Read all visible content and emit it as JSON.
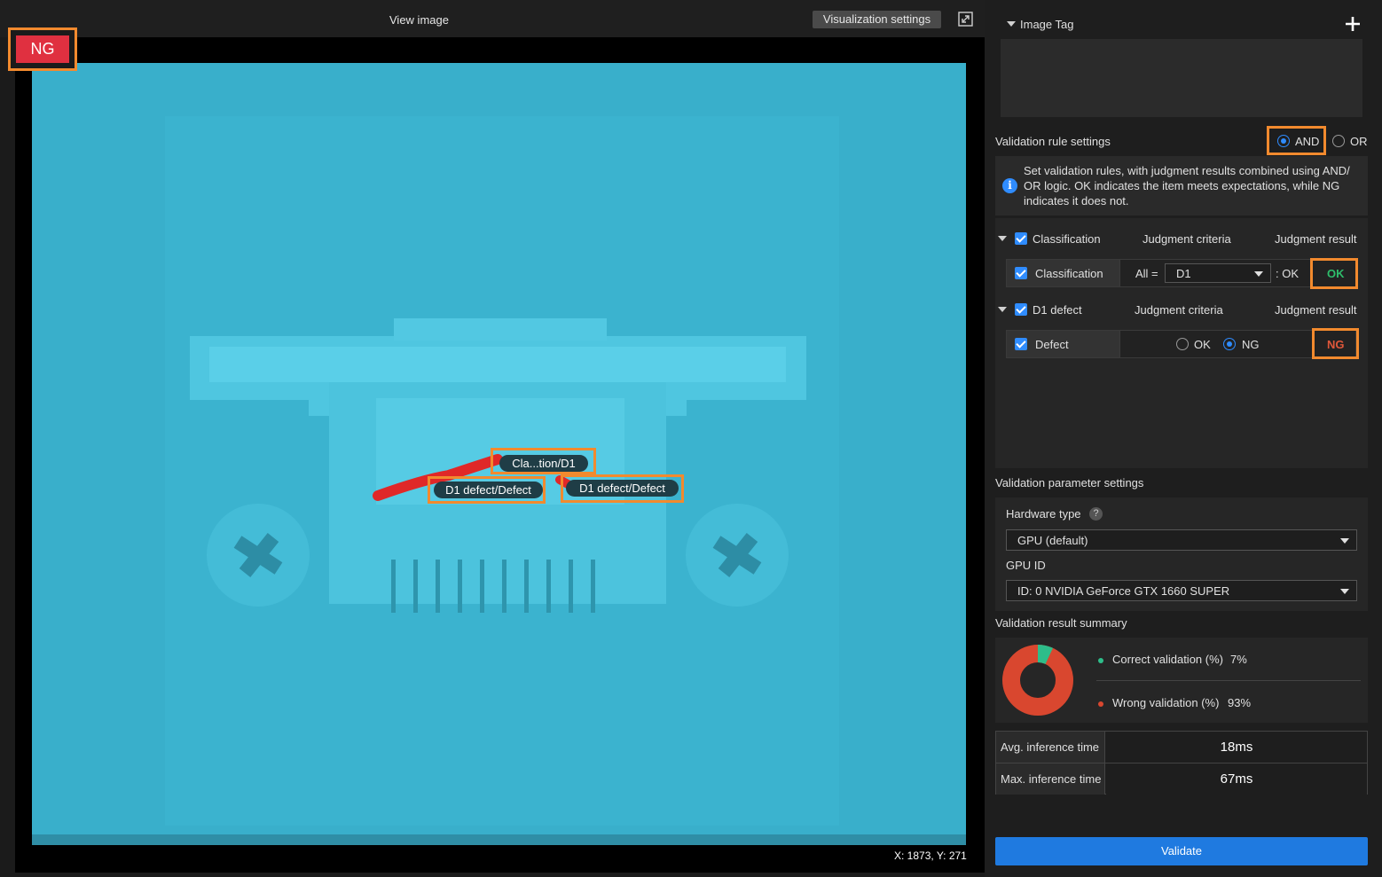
{
  "viewer": {
    "title": "View image",
    "visualization_settings_label": "Visualization settings",
    "result_badge": "NG",
    "coords": "X: 1873, Y: 271",
    "tags": [
      "Cla...tion/D1",
      "D1 defect/Defect",
      "D1 defect/Defect"
    ]
  },
  "image_tag": {
    "title": "Image Tag"
  },
  "validation_rule": {
    "title": "Validation rule settings",
    "and_label": "AND",
    "or_label": "OR",
    "selected": "AND",
    "info": "Set validation rules, with judgment results combined using AND/ OR logic. OK indicates the item meets expectations, while NG indicates it does not.",
    "groups": [
      {
        "name": "Classification",
        "criteria_header": "Judgment criteria",
        "result_header": "Judgment result",
        "row_label": "Classification",
        "all_label": "All =",
        "class_value": "D1",
        "expect_label": ": OK",
        "result": "OK",
        "result_color": "#2ebd6b"
      },
      {
        "name": "D1 defect",
        "criteria_header": "Judgment criteria",
        "result_header": "Judgment result",
        "row_label": "Defect",
        "ok_label": "OK",
        "ng_label": "NG",
        "selected": "NG",
        "result": "NG",
        "result_color": "#e0573a"
      }
    ]
  },
  "validation_params": {
    "title": "Validation parameter settings",
    "hardware_label": "Hardware type",
    "hardware_value": "GPU (default)",
    "gpu_label": "GPU ID",
    "gpu_value": "ID: 0  NVIDIA GeForce GTX 1660 SUPER"
  },
  "summary": {
    "title": "Validation result summary",
    "correct_label": "Correct validation (%)",
    "correct_value": "7%",
    "wrong_label": "Wrong validation (%)",
    "wrong_value": "93%",
    "correct_pct": 7,
    "wrong_pct": 93,
    "correct_color": "#2ebd8a",
    "wrong_color": "#d9472f"
  },
  "times": [
    {
      "label": "Avg. inference time",
      "value": "18ms"
    },
    {
      "label": "Max. inference time",
      "value": "67ms"
    }
  ],
  "validate_label": "Validate",
  "icons": {
    "expand": "expand-icon",
    "plus": "plus-icon",
    "info": "info-icon",
    "help": "help-icon"
  }
}
